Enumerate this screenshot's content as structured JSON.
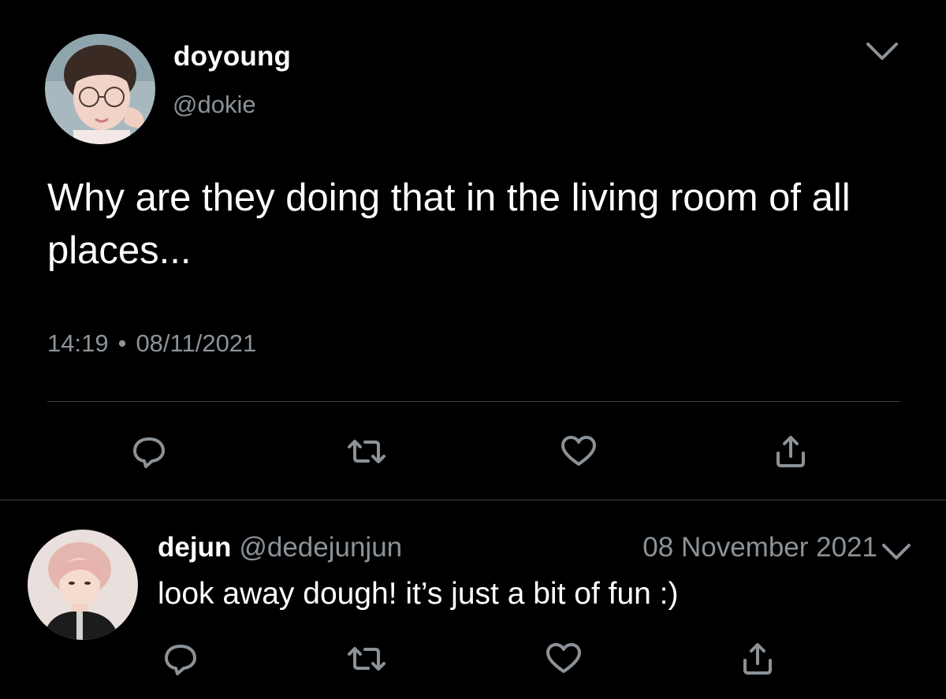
{
  "colors": {
    "background": "#000000",
    "text_primary": "#ffffff",
    "text_secondary": "#8b9298",
    "divider": "#3d4247"
  },
  "main_tweet": {
    "display_name": "doyoung",
    "handle": "@dokie",
    "text": "Why are they doing that in the living room of all places...",
    "time": "14:19",
    "separator": "•",
    "date": "08/11/2021",
    "actions": {
      "reply_icon": "reply-icon",
      "retweet_icon": "retweet-icon",
      "like_icon": "heart-icon",
      "share_icon": "share-icon"
    }
  },
  "reply_tweet": {
    "display_name": "dejun",
    "handle": "@dedejunjun",
    "date": "08 November 2021",
    "text": "look away dough! it’s just a bit of fun :)",
    "actions": {
      "reply_icon": "reply-icon",
      "retweet_icon": "retweet-icon",
      "like_icon": "heart-icon",
      "share_icon": "share-icon"
    }
  }
}
